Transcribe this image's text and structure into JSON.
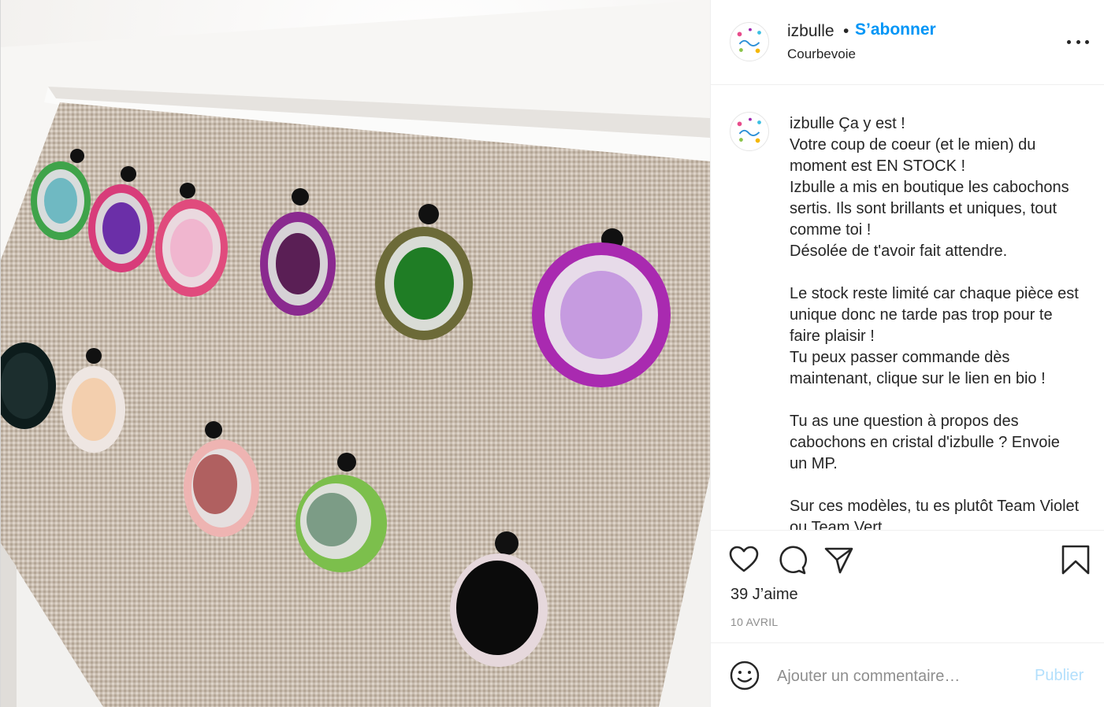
{
  "post": {
    "image_alt": "",
    "header": {
      "username": "izbulle",
      "dot": "•",
      "follow_label": "S’abonner",
      "location": "Courbevoie",
      "more_icon": "more-options-icon"
    },
    "caption": {
      "username": "izbulle",
      "text": " Ça y est !\nVotre coup de coeur (et le mien) du moment est EN STOCK !\nIzbulle a mis en boutique les cabochons sertis. Ils sont brillants et uniques, tout comme toi !\nDésolée de t'avoir fait attendre.\n\nLe stock reste limité car chaque pièce est unique donc ne tarde pas trop pour te faire plaisir !\nTu peux passer commande dès maintenant, clique sur le lien en bio !\n\nTu as une question à propos des cabochons en cristal d'izbulle ? Envoie un MP.\n\nSur ces modèles, tu es plutôt Team Violet ou Team Vert"
    },
    "actions": {
      "icons": [
        "heart-icon",
        "comment-icon",
        "share-icon",
        "bookmark-icon"
      ],
      "likes": "39 J’aime",
      "date": "10 AVRIL"
    },
    "comment_bar": {
      "placeholder": "Ajouter un commentaire…",
      "publish_label": "Publier",
      "emoji_icon": "emoji-icon"
    },
    "colors": {
      "accent": "#0095f6",
      "publish_disabled": "#b2dffc",
      "text": "#262626",
      "muted": "#8e8e8e",
      "border": "#efefef"
    }
  }
}
